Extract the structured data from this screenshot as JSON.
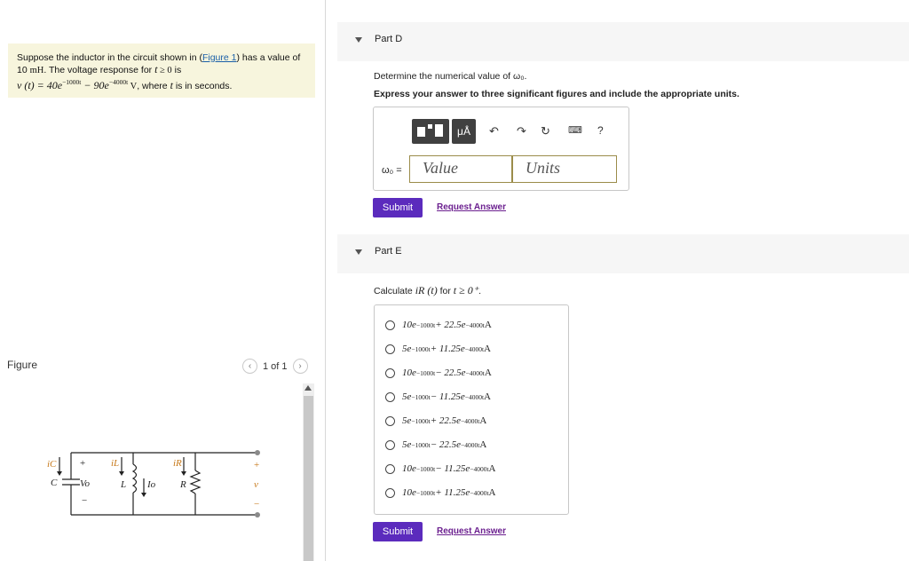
{
  "problem": {
    "line1_a": "Suppose the inductor in the circuit shown in (",
    "figure_link": "Figure 1",
    "line1_b": ") has a value of",
    "line2_a": "10 ",
    "unit_mH": "mH",
    "line2_b": ". The voltage response for ",
    "t_var": "t",
    "cond": " ≥ 0",
    "line2_c": " is",
    "v_t": "v (t) = 40e",
    "exp1": "−1000t",
    "minus": " − 90e",
    "exp2": "−4000t",
    "unit_V": " V",
    "where": ", where ",
    "t2": "t",
    "seconds": " is in seconds."
  },
  "figure": {
    "label": "Figure",
    "pager": "1 of 1",
    "prev_icon": "chevron-left-icon",
    "next_icon": "chevron-right-icon",
    "circuit": {
      "ic": "iC",
      "plus": "+",
      "minus": "−",
      "C": "C",
      "Vo": "Vo",
      "iL": "iL",
      "L": "L",
      "Io": "Io",
      "iR": "iR",
      "R": "R",
      "v": "v"
    }
  },
  "partD": {
    "title": "Part D",
    "prompt_text": "Determine the numerical value of ω₀.",
    "instructions": "Express your answer to three significant figures and include the appropriate units.",
    "toolbar": {
      "template_icon": "template-icon",
      "units_label": "μÅ",
      "undo_icon": "undo-icon",
      "redo_icon": "redo-icon",
      "reset_icon": "reset-icon",
      "keyboard_icon": "keyboard-icon",
      "help_label": "?"
    },
    "omega_label": "ω₀ =",
    "value_placeholder": "Value",
    "units_placeholder": "Units",
    "submit_label": "Submit",
    "request_label": "Request Answer"
  },
  "partE": {
    "title": "Part E",
    "calc_text": "Calculate",
    "calc_var": "iR (t)",
    "calc_for": " for ",
    "calc_cond": "t ≥ 0⁺",
    "calc_end": ".",
    "choices": [
      {
        "a": "10e",
        "e1": "−1000t",
        "op": " + 22.5e",
        "e2": "−4000t",
        "u": " A"
      },
      {
        "a": "5e",
        "e1": "−1000t",
        "op": " + 11.25e",
        "e2": "−4000t",
        "u": " A"
      },
      {
        "a": "10e",
        "e1": "−1000t",
        "op": " − 22.5e",
        "e2": "−4000t",
        "u": " A"
      },
      {
        "a": "5e",
        "e1": "−1000t",
        "op": " − 11.25e",
        "e2": "−4000t",
        "u": " A"
      },
      {
        "a": "5e",
        "e1": "−1000t",
        "op": " + 22.5e",
        "e2": "−4000t",
        "u": " A"
      },
      {
        "a": "5e",
        "e1": "−1000t",
        "op": " − 22.5e",
        "e2": "−4000t",
        "u": " A"
      },
      {
        "a": "10e",
        "e1": "−1000t",
        "op": " − 11.25e",
        "e2": "−4000t",
        "u": " A"
      },
      {
        "a": "10e",
        "e1": "−1000t",
        "op": " + 11.25e",
        "e2": "−4000t",
        "u": " A"
      }
    ],
    "submit_label": "Submit",
    "request_label": "Request Answer"
  },
  "colors": {
    "submit_bg": "#5b2bbd",
    "problem_bg": "#f7f5dd",
    "link": "#1a5fa8"
  }
}
